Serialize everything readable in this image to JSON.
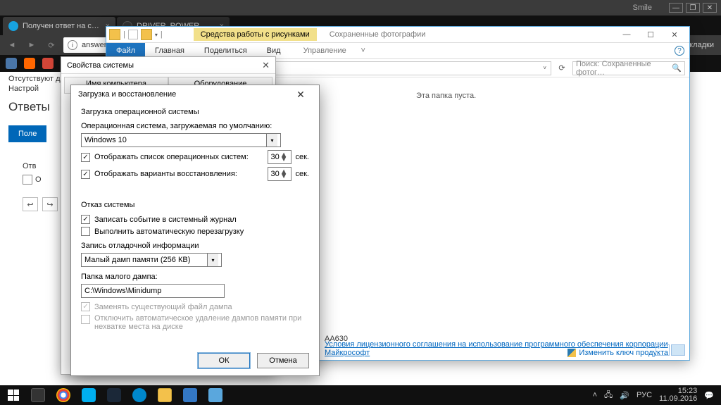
{
  "titlebar": {
    "smile": "Smile",
    "min": "—",
    "max": "❐",
    "close": "✕"
  },
  "tabs": [
    {
      "title": "Получен ответ на следу",
      "fav": "#17a2e0"
    },
    {
      "title": "DRIVER_POWER_STATE_F",
      "fav": "#fff"
    }
  ],
  "addr": {
    "url": "answer",
    "info": "i",
    "bookmarks_label": "кладки"
  },
  "page": {
    "line1": "Отсутствуют дампы",
    "line2": "Настрой",
    "answers_hdr": "Ответы",
    "useful": "Поле",
    "answer_label": "Отв",
    "checkbox_label": "О"
  },
  "explorer": {
    "ribbon_tools": "Средства работы с рисунками",
    "ribbon_tools2": "Сохраненные фотографии",
    "tabs": {
      "file": "Файл",
      "home": "Главная",
      "share": "Поделиться",
      "view": "Вид",
      "manage": "Управление"
    },
    "path_sep": "›",
    "path_item": "Сохраненные фотографии",
    "search_placeholder": "Поиск: Сохраненные фотог…",
    "empty": "Эта папка пуста.",
    "license": "Условия лицензионного соглашения на использование программного обеспечения корпорации Майкрософт",
    "product_key": "Изменить ключ продукта",
    "code": "AA630"
  },
  "sysprop": {
    "title": "Свойства системы",
    "tab1": "Имя компьютера",
    "tab2": "Оборудование"
  },
  "dlg": {
    "title": "Загрузка и восстановление",
    "grp1": "Загрузка операционной системы",
    "default_os_label": "Операционная система, загружаемая по умолчанию:",
    "default_os": "Windows 10",
    "show_list": "Отображать список операционных систем:",
    "show_recovery": "Отображать варианты восстановления:",
    "sec": "сек.",
    "n1": "30",
    "n2": "30",
    "grp2": "Отказ системы",
    "log": "Записать событие в системный журнал",
    "reboot": "Выполнить автоматическую перезагрузку",
    "dump_label": "Запись отладочной информации",
    "dump_type": "Малый дамп памяти (256 КВ)",
    "dump_folder_label": "Папка малого дампа:",
    "dump_folder": "C:\\Windows\\Minidump",
    "overwrite": "Заменять существующий файл дампа",
    "disable_auto": "Отключить автоматическое удаление дампов памяти при нехватке места на диске",
    "ok": "ОК",
    "cancel": "Отмена"
  },
  "taskbar": {
    "lang": "РУС",
    "time": "15:23",
    "date": "11.09.2016"
  }
}
